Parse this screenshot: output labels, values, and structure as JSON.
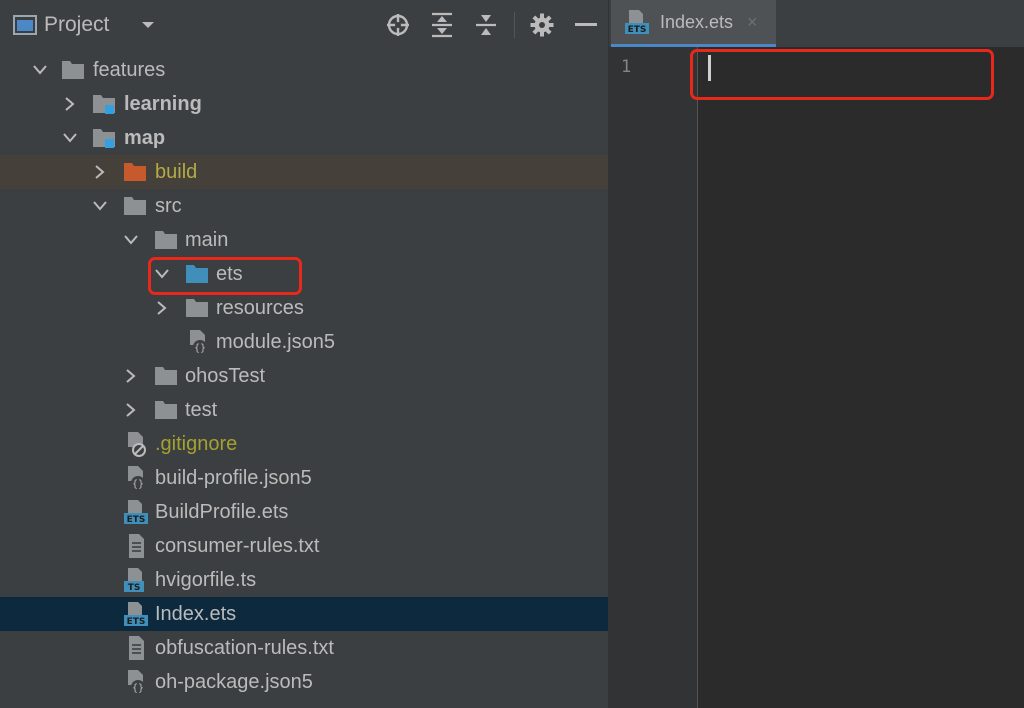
{
  "project_panel": {
    "title": "Project",
    "toolbar": [
      "locate-icon",
      "expand-all-icon",
      "collapse-all-icon",
      "gear-icon",
      "minimize-icon"
    ]
  },
  "tree": [
    {
      "label": "features",
      "type": "folder",
      "expanded": true
    },
    {
      "label": "learning",
      "type": "module",
      "expanded": false
    },
    {
      "label": "map",
      "type": "module",
      "expanded": true
    },
    {
      "label": "build",
      "type": "build-folder",
      "expanded": false
    },
    {
      "label": "src",
      "type": "folder",
      "expanded": true
    },
    {
      "label": "main",
      "type": "folder",
      "expanded": true
    },
    {
      "label": "ets",
      "type": "source-folder",
      "expanded": true
    },
    {
      "label": "resources",
      "type": "folder",
      "expanded": false
    },
    {
      "label": "module.json5",
      "type": "json5-file"
    },
    {
      "label": "ohosTest",
      "type": "folder",
      "expanded": false
    },
    {
      "label": "test",
      "type": "folder",
      "expanded": false
    },
    {
      "label": ".gitignore",
      "type": "ignore-file"
    },
    {
      "label": "build-profile.json5",
      "type": "json5-file"
    },
    {
      "label": "BuildProfile.ets",
      "type": "ets-file"
    },
    {
      "label": "consumer-rules.txt",
      "type": "text-file"
    },
    {
      "label": "hvigorfile.ts",
      "type": "ts-file"
    },
    {
      "label": "Index.ets",
      "type": "ets-file",
      "selected": true
    },
    {
      "label": "obfuscation-rules.txt",
      "type": "text-file"
    },
    {
      "label": "oh-package.json5",
      "type": "json5-file"
    }
  ],
  "editor": {
    "tab": {
      "label": "Index.ets",
      "close": "×",
      "badge": "ETS"
    },
    "line_number": "1"
  },
  "colors": {
    "panel_bg": "#3c3f41",
    "editor_bg": "#2b2b2b",
    "selection": "#0d293e",
    "highlight": "#e8281a",
    "folder": "#8d9194",
    "source_folder": "#3f8fba"
  }
}
